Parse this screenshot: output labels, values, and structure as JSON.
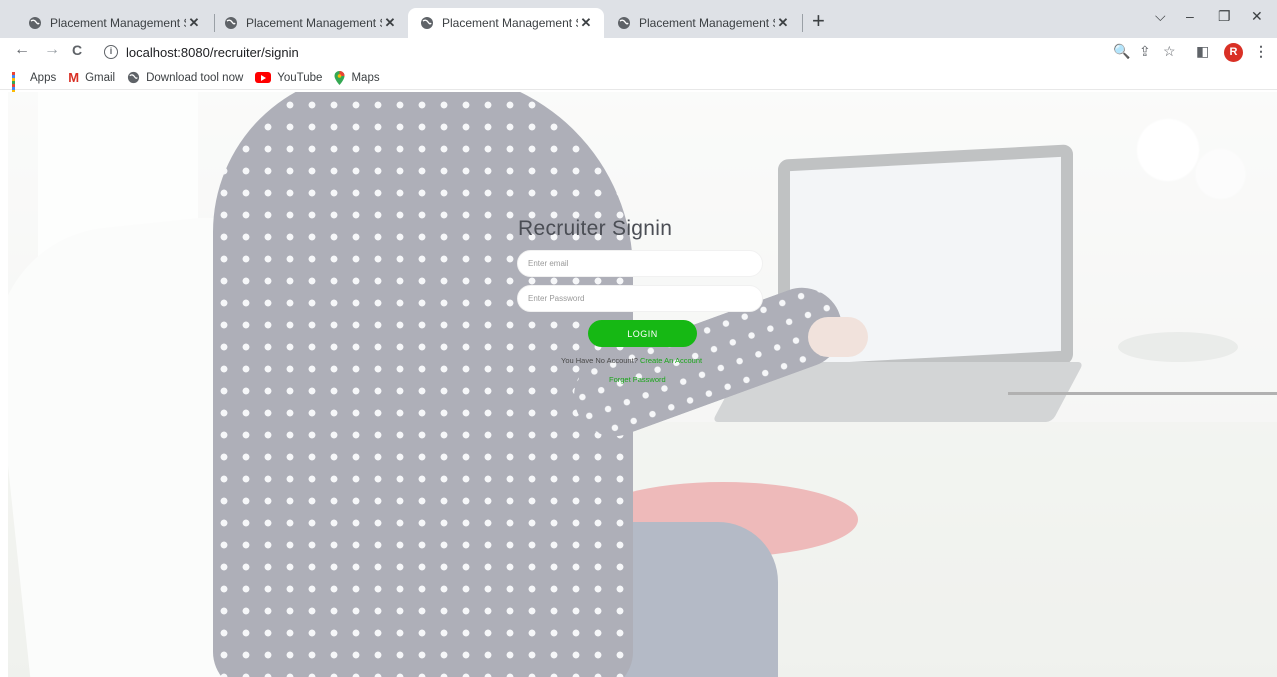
{
  "browser": {
    "tabs": [
      {
        "title": "Placement Management System",
        "active": false
      },
      {
        "title": "Placement Management System",
        "active": false
      },
      {
        "title": "Placement Management System",
        "active": true
      },
      {
        "title": "Placement Management System",
        "active": false
      }
    ],
    "close_glyph": "✕",
    "new_tab_glyph": "+",
    "window_controls": {
      "dropdown": "⌵",
      "minimize": "–",
      "maximize": "❐",
      "close": "✕"
    },
    "nav": {
      "back": "←",
      "forward": "→",
      "reload": "C"
    },
    "url": "localhost:8080/recruiter/signin",
    "toolbar_icons": {
      "zoom": "🔍",
      "share": "⇪",
      "bookmark": "☆",
      "sidepanel": "◧",
      "menu": "⋮"
    },
    "profile_initial": "R",
    "bookmarks": [
      {
        "label": "Apps",
        "icon": "apps-grid-icon"
      },
      {
        "label": "Gmail",
        "icon": "gmail-icon"
      },
      {
        "label": "Download tool now",
        "icon": "globe-icon"
      },
      {
        "label": "YouTube",
        "icon": "youtube-icon"
      },
      {
        "label": "Maps",
        "icon": "maps-icon"
      }
    ]
  },
  "signin": {
    "title": "Recruiter Signin",
    "email_placeholder": "Enter email",
    "password_placeholder": "Enter Password",
    "login_label": "LOGIN",
    "no_account_text": "You Have No Account?",
    "create_account_link": "Create An Account",
    "forgot_password_link": "Forget Password",
    "accent_color": "#16b814"
  }
}
